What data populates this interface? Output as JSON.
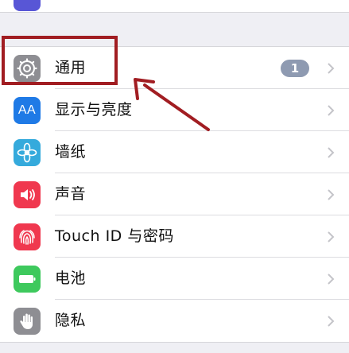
{
  "settings": {
    "items": [
      {
        "label": "通用",
        "icon": "gear-icon",
        "icon_bg": "#8e8e93",
        "badge": "1"
      },
      {
        "label": "显示与亮度",
        "icon": "text-size-icon",
        "icon_bg": "#1f7ae6",
        "icon_text": "AA"
      },
      {
        "label": "墙纸",
        "icon": "flower-icon",
        "icon_bg": "#35aadc"
      },
      {
        "label": "声音",
        "icon": "speaker-icon",
        "icon_bg": "#f0384f"
      },
      {
        "label": "Touch ID 与密码",
        "icon": "fingerprint-icon",
        "icon_bg": "#f0384f"
      },
      {
        "label": "电池",
        "icon": "battery-icon",
        "icon_bg": "#3ec95d"
      },
      {
        "label": "隐私",
        "icon": "hand-icon",
        "icon_bg": "#8e8e93"
      }
    ]
  },
  "annotation": {
    "color": "#a11d22"
  }
}
